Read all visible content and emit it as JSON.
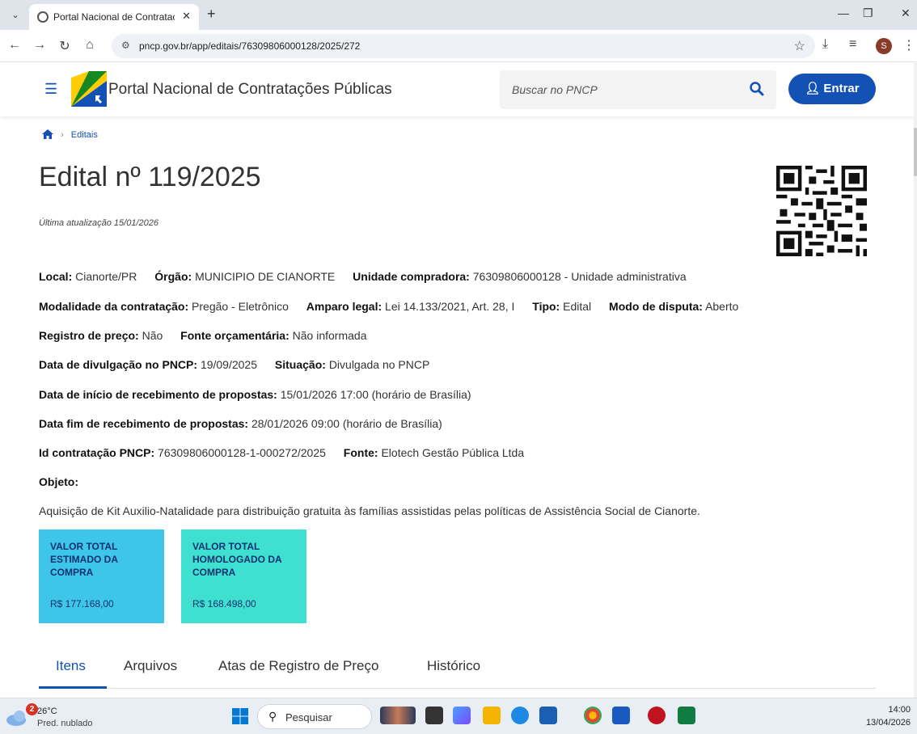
{
  "browser": {
    "tab_title": "Portal Nacional de Contrataçõe",
    "tab_close": "✕",
    "new_tab": "+",
    "url": "pncp.gov.br/app/editais/76309806000128/2025/272",
    "profile_initial": "S"
  },
  "header": {
    "portal_title": "Portal Nacional de Contratações Públicas",
    "search_placeholder": "Buscar no PNCP",
    "login_label": "Entrar"
  },
  "breadcrumb": {
    "current": "Editais"
  },
  "page": {
    "title": "Edital nº 119/2025",
    "updated": "Última atualização 15/01/2026"
  },
  "details": {
    "local_label": "Local:",
    "local_value": "Cianorte/PR",
    "orgao_label": "Órgão:",
    "orgao_value": "MUNICIPIO DE CIANORTE",
    "unidade_label": "Unidade compradora:",
    "unidade_value": "76309806000128 - Unidade administrativa",
    "modalidade_label": "Modalidade da contratação:",
    "modalidade_value": "Pregão - Eletrônico",
    "amparo_label": "Amparo legal:",
    "amparo_value": "Lei 14.133/2021, Art. 28, I",
    "tipo_label": "Tipo:",
    "tipo_value": "Edital",
    "disputa_label": "Modo de disputa:",
    "disputa_value": "Aberto",
    "registro_label": "Registro de preço:",
    "registro_value": "Não",
    "fonte_orc_label": "Fonte orçamentária:",
    "fonte_orc_value": "Não informada",
    "divulgacao_label": "Data de divulgação no PNCP:",
    "divulgacao_value": "19/09/2025",
    "situacao_label": "Situação:",
    "situacao_value": "Divulgada no PNCP",
    "inicio_label": "Data de início de recebimento de propostas:",
    "inicio_value": "15/01/2026 17:00 (horário de Brasília)",
    "fim_label": "Data fim de recebimento de propostas:",
    "fim_value": "28/01/2026 09:00 (horário de Brasília)",
    "id_label": "Id contratação PNCP:",
    "id_value": "76309806000128-1-000272/2025",
    "fonte_label": "Fonte:",
    "fonte_value": "Elotech Gestão Pública Ltda",
    "objeto_label": "Objeto:",
    "objeto_value": "Aquisição de Kit Auxilio-Natalidade para distribuição gratuita às famílias assistidas pelas políticas de Assistência Social de Cianorte."
  },
  "cards": [
    {
      "label": "VALOR TOTAL ESTIMADO DA COMPRA",
      "value": "R$ 177.168,00",
      "color": "#3ec6e8"
    },
    {
      "label": "VALOR TOTAL HOMOLOGADO DA COMPRA",
      "value": "R$ 168.498,00",
      "color": "#40e0d0"
    }
  ],
  "tabs": [
    {
      "label": "Itens"
    },
    {
      "label": "Arquivos"
    },
    {
      "label": "Atas de Registro de Preço"
    },
    {
      "label": "Histórico"
    }
  ],
  "taskbar": {
    "weather_badge": "2",
    "temperature": "26°C",
    "condition": "Pred. nublado",
    "search_label": "Pesquisar",
    "time": "14:00",
    "date": "13/04/2026"
  },
  "colors": {
    "primary": "#1351b4",
    "card_text": "#0c326f"
  }
}
